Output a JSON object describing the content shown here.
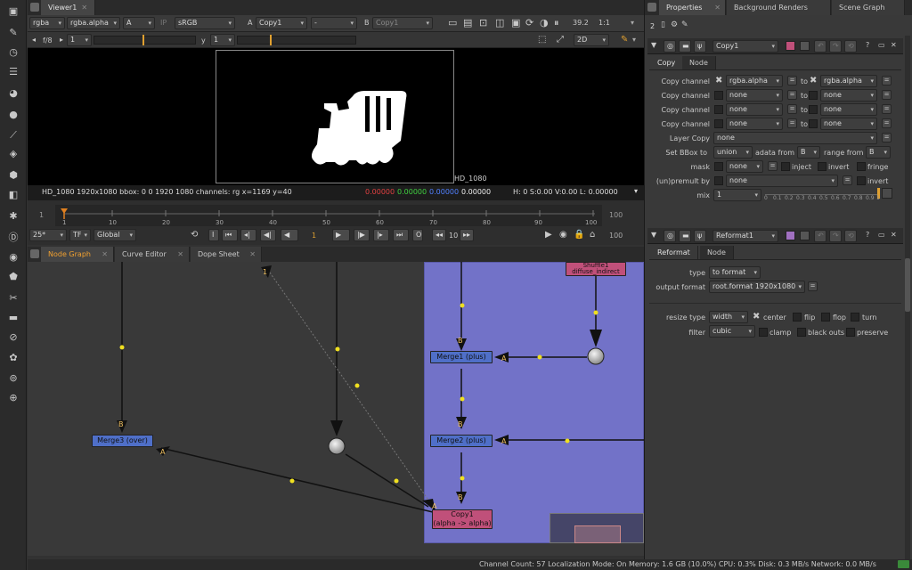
{
  "viewer": {
    "tab": "Viewer1",
    "channels": "rgba",
    "layer": "rgba.alpha",
    "channel_a": "A",
    "ip": "IP",
    "colorspace": "sRGB",
    "input_a_label": "A",
    "input_a": "Copy1",
    "wipe": "-",
    "input_b_label": "B",
    "input_b": "Copy1",
    "zoom": "39.2",
    "ratio": "1:1",
    "fstop": "f/8",
    "gain": "1",
    "gamma_label": "y",
    "gamma": "1",
    "view_mode": "2D",
    "format_label": "HD_1080",
    "info": "HD_1080 1920x1080  bbox: 0 0 1920 1080 channels: rg  x=1169 y=40",
    "r_val": "0.00000",
    "g_val": "0.00000",
    "b_val": "0.00000",
    "a_val": "0.00000",
    "hsv": "H:  0 S:0.00 V:0.00  L: 0.00000"
  },
  "timeline": {
    "start": "1",
    "end": "100",
    "ticks": [
      "1",
      "10",
      "20",
      "30",
      "40",
      "50",
      "60",
      "70",
      "80",
      "90",
      "100"
    ],
    "fps": "25*",
    "tf": "TF",
    "scope": "Global",
    "frame": "1",
    "step": "10",
    "end_field": "100",
    "in_field": "1"
  },
  "graph_tabs": [
    "Node Graph",
    "Curve Editor",
    "Dope Sheet"
  ],
  "nodes": {
    "merge3": "Merge3 (over)",
    "merge1": "Merge1 (plus)",
    "merge2": "Merge2 (plus)",
    "copy1_a": "Copy1",
    "copy1_b": "(alpha -> alpha)",
    "shuffle_a": "Shuffle1",
    "shuffle_b": "diffuse_indirect",
    "in_b": "B",
    "in_a": "A",
    "in_1": "1"
  },
  "props_tabs": [
    "Properties",
    "Background Renders",
    "Scene Graph"
  ],
  "props_count": "2",
  "copy_panel": {
    "name": "Copy1",
    "tabs": [
      "Copy",
      "Node"
    ],
    "rows": [
      {
        "label": "Copy channel",
        "from": "rgba.alpha",
        "to": "rgba.alpha"
      },
      {
        "label": "Copy channel",
        "from": "none",
        "to": "none"
      },
      {
        "label": "Copy channel",
        "from": "none",
        "to": "none"
      },
      {
        "label": "Copy channel",
        "from": "none",
        "to": "none"
      }
    ],
    "to_label": "to",
    "layer_copy_label": "Layer Copy",
    "layer_copy": "none",
    "bbox_label": "Set BBox to",
    "bbox": "union",
    "adata_label": "adata from",
    "adata": "B",
    "range_label": "range from",
    "range": "B",
    "mask_label": "mask",
    "mask": "none",
    "inject": "inject",
    "invert": "invert",
    "fringe": "fringe",
    "premult_label": "(un)premult by",
    "premult": "none",
    "invert2": "invert",
    "mix_label": "mix",
    "mix": "1",
    "mix_ticks": [
      "0",
      "0.1",
      "0.2",
      "0.3",
      "0.4",
      "0.5",
      "0.6",
      "0.7",
      "0.8",
      "0.9",
      "1"
    ]
  },
  "reformat_panel": {
    "name": "Reformat1",
    "tabs": [
      "Reformat",
      "Node"
    ],
    "type_label": "type",
    "type": "to format",
    "format_label": "output format",
    "format": "root.format 1920x1080",
    "resize_label": "resize type",
    "resize": "width",
    "center": "center",
    "flip": "flip",
    "flop": "flop",
    "turn": "turn",
    "filter_label": "filter",
    "filter": "cubic",
    "clamp": "clamp",
    "black_outside": "black outs",
    "preserve": "preserve"
  },
  "status_bar": "Channel Count: 57  Localization Mode: On  Memory: 1.6 GB (10.0%)  CPU: 0.3%  Disk: 0.3 MB/s  Network: 0.0 MB/s",
  "colors": {
    "backdrop": "#7272c8",
    "merge": "#4f6fc8",
    "copy": "#c0507a",
    "accent": "#f0a030"
  }
}
